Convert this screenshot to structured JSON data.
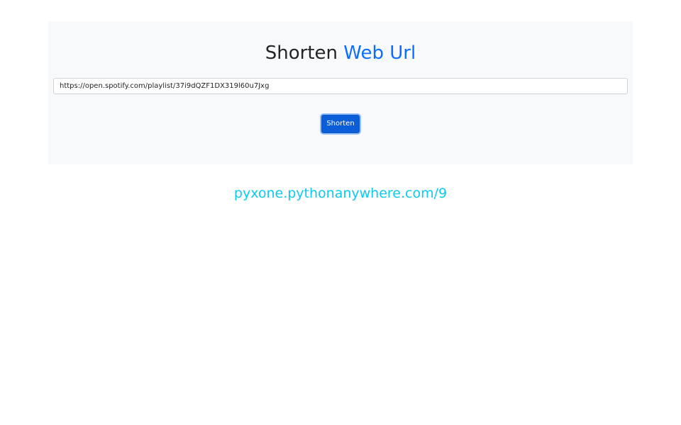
{
  "header": {
    "title_part1": "Shorten",
    "title_part2": "Web Url",
    "accent_color": "#0d6efd"
  },
  "form": {
    "url_value": "https://open.spotify.com/playlist/37i9dQZF1DX319l60u7Jxg",
    "submit_label": "Shorten",
    "button_color": "#0b5ed7"
  },
  "result": {
    "short_url": "pyxone.pythonanywhere.com/9",
    "link_color": "#0dcaf0"
  }
}
